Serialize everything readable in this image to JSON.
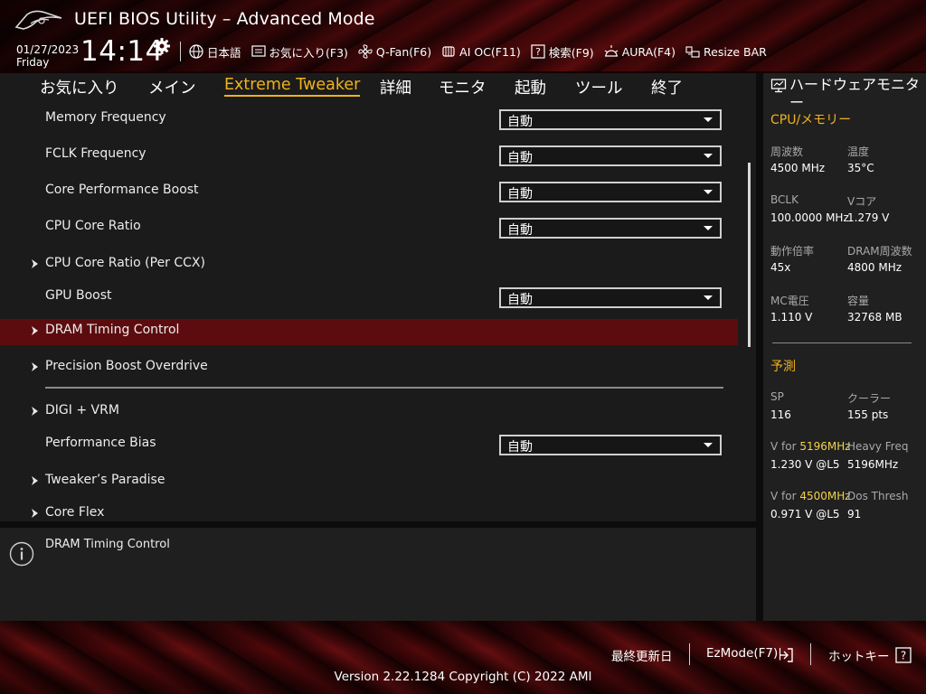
{
  "app": {
    "title": "UEFI BIOS Utility – Advanced Mode",
    "date": "01/27/2023",
    "weekday": "Friday",
    "time": "14:14"
  },
  "toolbar": [
    {
      "icon": "globe-icon",
      "label": "日本語"
    },
    {
      "icon": "favorites-icon",
      "label": "お気に入り(F3)"
    },
    {
      "icon": "fan-icon",
      "label": "Q-Fan(F6)"
    },
    {
      "icon": "ai-oc-icon",
      "label": "AI OC(F11)"
    },
    {
      "icon": "help-search-icon",
      "label": "検索(F9)"
    },
    {
      "icon": "aura-icon",
      "label": "AURA(F4)"
    },
    {
      "icon": "resize-bar-icon",
      "label": "Resize BAR"
    }
  ],
  "tabs": [
    {
      "label": "お気に入り",
      "active": false
    },
    {
      "label": "メイン",
      "active": false
    },
    {
      "label": "Extreme Tweaker",
      "active": true
    },
    {
      "label": "詳細",
      "active": false
    },
    {
      "label": "モニタ",
      "active": false
    },
    {
      "label": "起動",
      "active": false
    },
    {
      "label": "ツール",
      "active": false
    },
    {
      "label": "終了",
      "active": false
    }
  ],
  "settings": [
    {
      "label": "Memory Frequency",
      "value": "自動",
      "submenu": false
    },
    {
      "label": "FCLK Frequency",
      "value": "自動",
      "submenu": false
    },
    {
      "label": "Core Performance Boost",
      "value": "自動",
      "submenu": false
    },
    {
      "label": "CPU Core Ratio",
      "value": "自動",
      "submenu": false
    },
    {
      "label": "CPU Core Ratio (Per CCX)",
      "value": null,
      "submenu": true
    },
    {
      "label": "GPU Boost",
      "value": "自動",
      "submenu": false
    },
    {
      "label": "DRAM Timing Control",
      "value": null,
      "submenu": true,
      "selected": true
    },
    {
      "label": "Precision Boost Overdrive",
      "value": null,
      "submenu": true
    },
    {
      "label": "DIGI + VRM",
      "value": null,
      "submenu": true
    },
    {
      "label": "Performance Bias",
      "value": "自動",
      "submenu": false
    },
    {
      "label": "Tweaker’s Paradise",
      "value": null,
      "submenu": true
    },
    {
      "label": "Core Flex",
      "value": null,
      "submenu": true
    }
  ],
  "help": {
    "text": "DRAM Timing Control"
  },
  "monitor": {
    "title": "ハードウェアモニター",
    "cpu_section": "CPU/メモリー",
    "cpu_items": [
      {
        "label": "周波数",
        "value": "4500 MHz"
      },
      {
        "label": "温度",
        "value": "35°C"
      },
      {
        "label": "BCLK",
        "value": "100.0000 MHz"
      },
      {
        "label": "Vコア",
        "value": "1.279 V"
      },
      {
        "label": "動作倍率",
        "value": "45x"
      },
      {
        "label": "DRAM周波数",
        "value": "4800 MHz"
      },
      {
        "label": "MC電圧",
        "value": "1.110 V"
      },
      {
        "label": "容量",
        "value": "32768 MB"
      }
    ],
    "predict_section": "予測",
    "predict_items": [
      {
        "label": "SP",
        "value": "116"
      },
      {
        "label": "クーラー",
        "value": "155 pts"
      },
      {
        "label_prefix": "V for ",
        "label_highlight": "5196MHz",
        "value": "1.230 V @L5"
      },
      {
        "label": "Heavy Freq",
        "value": "5196MHz"
      },
      {
        "label_prefix": "V for ",
        "label_highlight": "4500MHz",
        "value": "0.971 V @L5"
      },
      {
        "label": "Dos Thresh",
        "value": "91"
      }
    ]
  },
  "footer": {
    "last_modified": "最終更新日",
    "ezmode": "EzMode(F7)|",
    "hotkeys": "ホットキー",
    "version": "Version 2.22.1284 Copyright (C) 2022 AMI"
  },
  "colors": {
    "accent": "#f0b21e",
    "highlight_row": "#5c0c0f",
    "panel_bg": "#1b1b1b",
    "monitor_highlight": "#f3d24a"
  }
}
